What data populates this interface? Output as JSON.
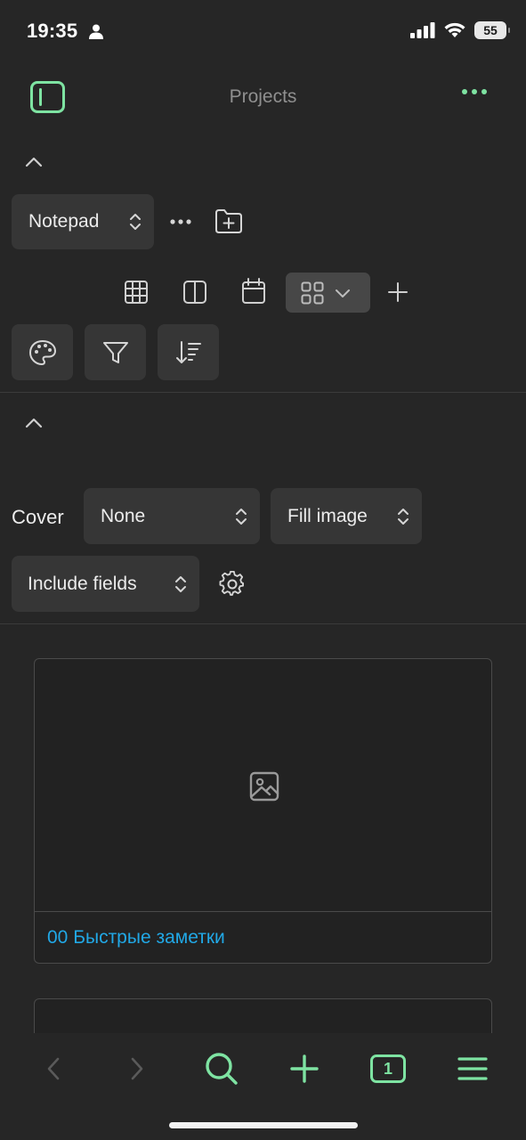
{
  "status_bar": {
    "time": "19:35",
    "battery": "55"
  },
  "header": {
    "title": "Projects"
  },
  "notepad_select": {
    "label": "Notepad"
  },
  "cover": {
    "label": "Cover",
    "cover_value": "None",
    "fit_value": "Fill image",
    "fields_value": "Include fields"
  },
  "cards": [
    {
      "title": "00 Быстрые заметки"
    }
  ],
  "bottom_nav": {
    "tab_count": "1"
  },
  "colors": {
    "accent": "#7ee3a2",
    "link": "#21a8e6",
    "background": "#262626",
    "control": "#363636"
  }
}
